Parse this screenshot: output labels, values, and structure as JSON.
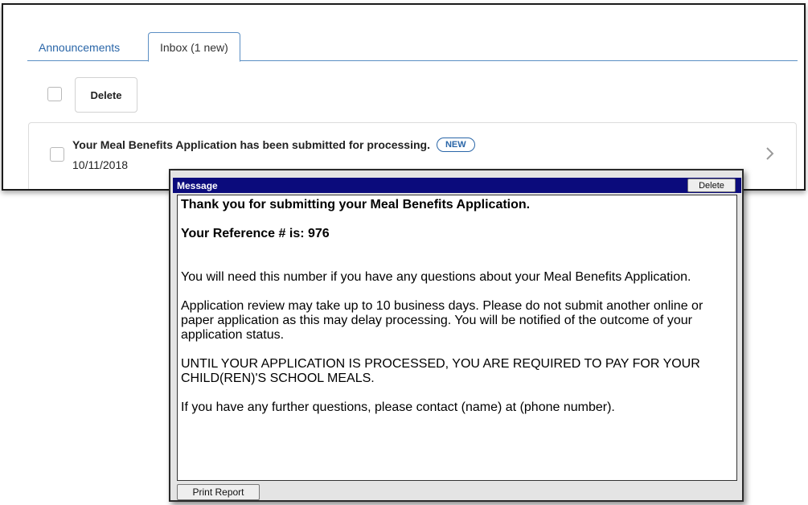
{
  "tabs": [
    {
      "label": "Announcements"
    },
    {
      "label": "Inbox (1 new)"
    }
  ],
  "toolbar": {
    "delete_label": "Delete"
  },
  "inbox_messages": [
    {
      "subject": "Your Meal Benefits Application has been submitted for processing.",
      "badge": "NEW",
      "date": "10/11/2018"
    }
  ],
  "message_window": {
    "title": "Message",
    "delete_label": "Delete",
    "heading": "Thank you for submitting your Meal Benefits Application.",
    "reference": "Your Reference # is: 976",
    "paragraphs": [
      "You will need this number if you have any questions about your Meal Benefits Application.",
      "Application review may take up to 10 business days.  Please do not submit another online or paper application as this may delay processing.  You will be notified of the outcome of your application status.",
      "UNTIL YOUR APPLICATION IS PROCESSED, YOU ARE REQUIRED TO PAY FOR YOUR CHILD(REN)'S SCHOOL MEALS.",
      "If you have any further questions, please contact (name) at (phone number)."
    ],
    "print_label": "Print Report"
  },
  "icons": {
    "chevron": "chevron-right-icon"
  },
  "colors": {
    "tab_link": "#2a66a8",
    "titlebar": "#0b0b7c"
  }
}
